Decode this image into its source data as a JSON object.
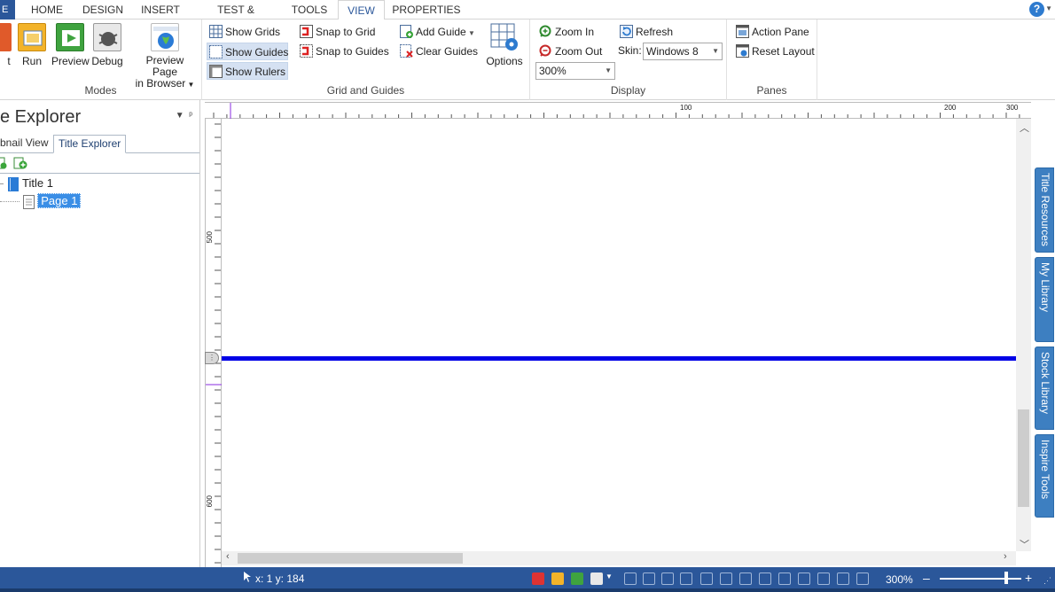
{
  "ribbon": {
    "file_tab": "E",
    "tabs": [
      {
        "label": "HOME"
      },
      {
        "label": "DESIGN"
      },
      {
        "label": "INSERT"
      },
      {
        "label": "TEST & SURVEY"
      },
      {
        "label": "TOOLS"
      },
      {
        "label": "VIEW",
        "active": true
      },
      {
        "label": "PROPERTIES"
      }
    ],
    "help": "?",
    "modes": {
      "partial_label": "t",
      "run": "Run",
      "preview": "Preview",
      "debug": "Debug",
      "preview_page_line1": "Preview Page",
      "preview_page_line2": "in Browser",
      "group_label": "Modes"
    },
    "grid_guides": {
      "show_grids": "Show Grids",
      "show_guides": "Show Guides",
      "show_rulers": "Show Rulers",
      "snap_to_grid": "Snap to Grid",
      "snap_to_guides": "Snap to Guides",
      "add_guide": "Add Guide",
      "clear_guides": "Clear Guides",
      "options": "Options",
      "group_label": "Grid and Guides"
    },
    "display": {
      "zoom_in": "Zoom In",
      "zoom_out": "Zoom Out",
      "zoom_value": "300%",
      "refresh": "Refresh",
      "skin_label": "Skin:",
      "skin_value": "Windows 8",
      "group_label": "Display"
    },
    "panes": {
      "action_pane": "Action Pane",
      "reset_layout": "Reset Layout",
      "group_label": "Panes"
    }
  },
  "panel": {
    "title": "e Explorer",
    "tabs": [
      "bnail View",
      "Title Explorer"
    ],
    "tree": {
      "title_node": "Title 1",
      "page_node": "Page 1"
    }
  },
  "ruler": {
    "h_labels": [
      "100",
      "200",
      "300"
    ],
    "v_labels": [
      "500",
      "600"
    ]
  },
  "dock_tabs": [
    "Title Resources",
    "My Library",
    "Stock Library",
    "Inspire Tools"
  ],
  "status": {
    "coords": "x: 1  y: 184",
    "zoom": "300%",
    "zoom_minus": "–",
    "zoom_plus": "+"
  },
  "colors": {
    "accent": "#2b579a",
    "guide_line": "#0000e6",
    "dock_tab": "#3d7fc1",
    "selection": "#3a8ee6"
  }
}
